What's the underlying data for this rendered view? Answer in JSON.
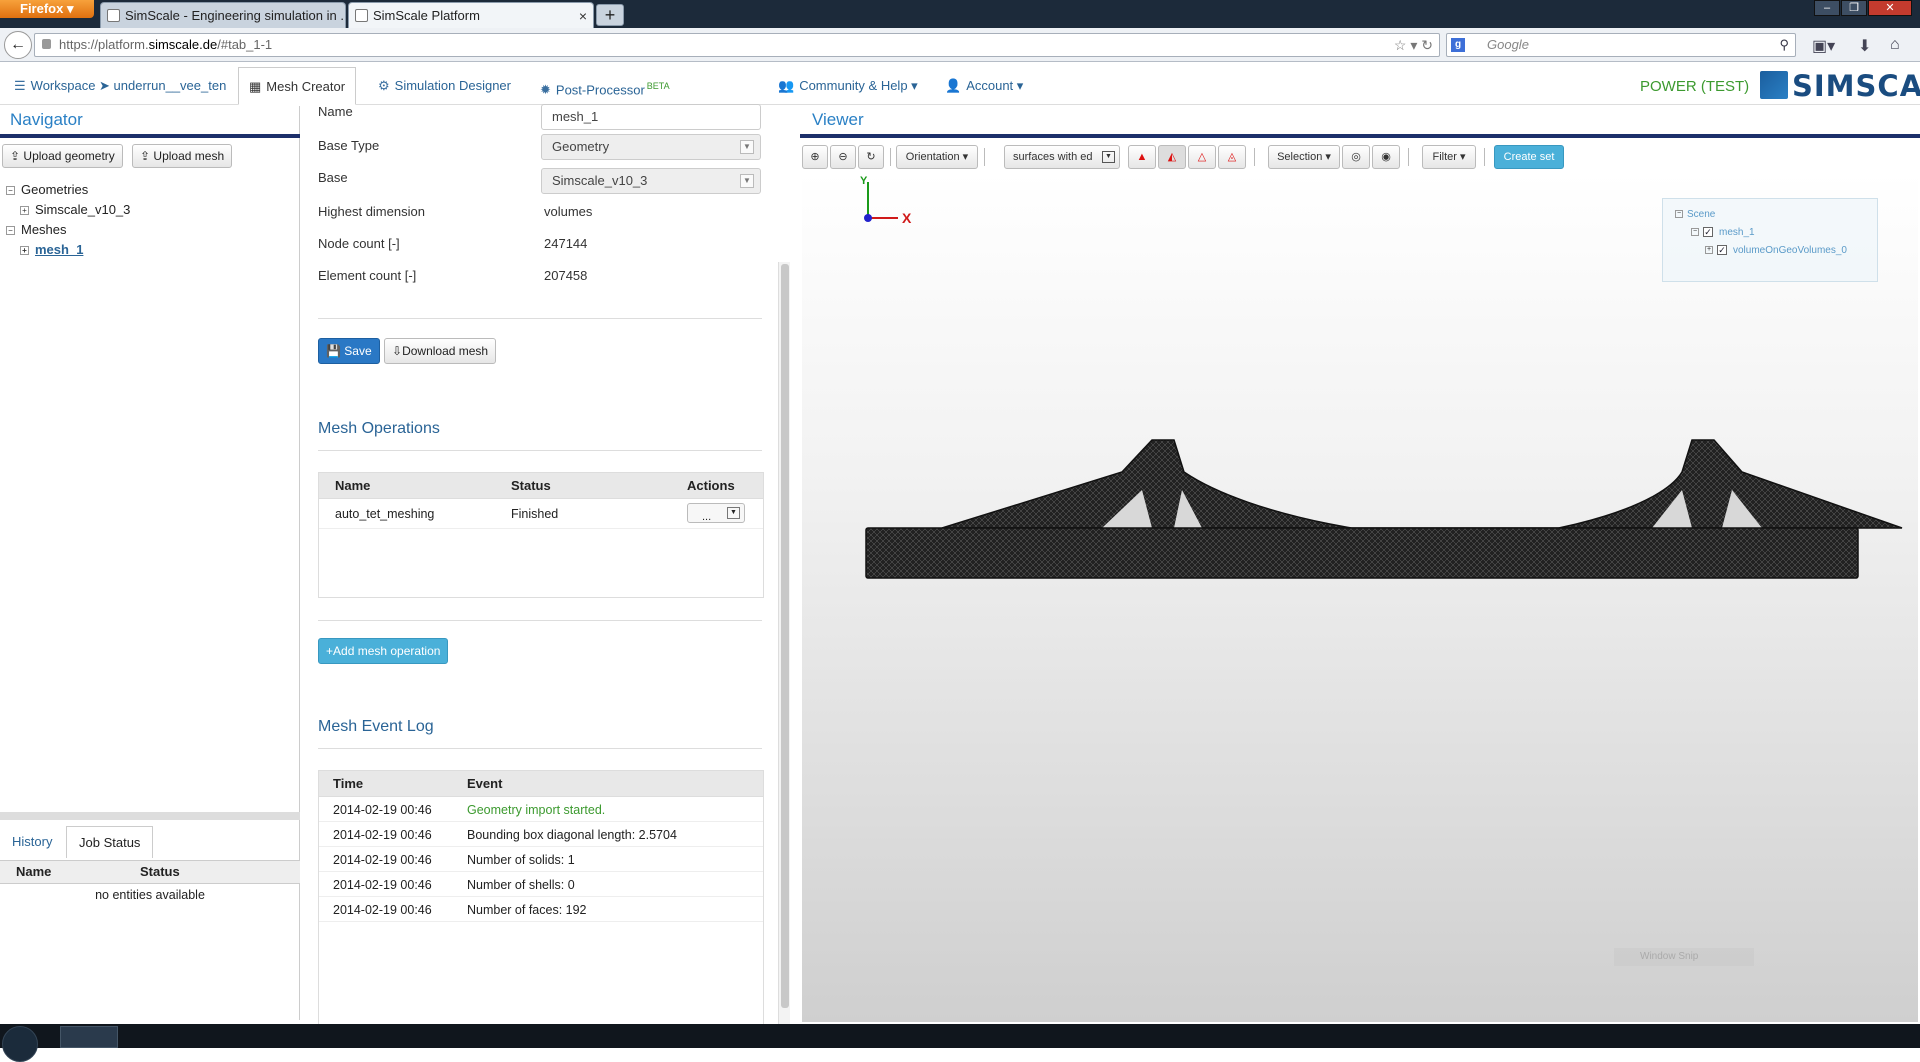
{
  "browser": {
    "app_button": "Firefox",
    "tabs": [
      {
        "label": "SimScale - Engineering simulation in ..."
      },
      {
        "label": "SimScale Platform"
      }
    ],
    "url_prefix": "https://platform.",
    "url_host": "simscale.de",
    "url_suffix": "/#tab_1-1",
    "search_placeholder": "Google"
  },
  "header": {
    "tabs": [
      {
        "label": "Workspace ➤ underrun__vee_ten"
      },
      {
        "label": "Mesh Creator"
      },
      {
        "label": "Simulation Designer"
      },
      {
        "label": "Post-Processor",
        "badge": "BETA"
      },
      {
        "label": "Community & Help"
      },
      {
        "label": "Account"
      }
    ],
    "plan": "POWER (TEST)",
    "logo_text": "SIMSCALE"
  },
  "navigator": {
    "title": "Navigator",
    "upload_geometry": "Upload geometry",
    "upload_mesh": "Upload mesh",
    "tree": {
      "geometries": "Geometries",
      "geometry_item": "Simscale_v10_3",
      "meshes": "Meshes",
      "mesh_item": "mesh_1"
    }
  },
  "jobs": {
    "tab_history": "History",
    "tab_status": "Job Status",
    "col_name": "Name",
    "col_status": "Status",
    "empty": "no entities available"
  },
  "mesh": {
    "name_label": "Name",
    "name_value": "mesh_1",
    "base_type_label": "Base Type",
    "base_type_value": "Geometry",
    "base_label": "Base",
    "base_value": "Simscale_v10_3",
    "highest_dim_label": "Highest dimension",
    "highest_dim_value": "volumes",
    "node_count_label": "Node count [-]",
    "node_count_value": "247144",
    "element_count_label": "Element count [-]",
    "element_count_value": "207458",
    "save": "Save",
    "download": "Download mesh"
  },
  "operations": {
    "title": "Mesh Operations",
    "col_name": "Name",
    "col_status": "Status",
    "col_actions": "Actions",
    "rows": [
      {
        "name": "auto_tet_meshing",
        "status": "Finished",
        "action": "..."
      }
    ],
    "add": "Add mesh operation"
  },
  "event_log": {
    "title": "Mesh Event Log",
    "col_time": "Time",
    "col_event": "Event",
    "rows": [
      {
        "time": "2014-02-19 00:46",
        "event": "Geometry import started."
      },
      {
        "time": "2014-02-19 00:46",
        "event": "Bounding box diagonal length: 2.5704"
      },
      {
        "time": "2014-02-19 00:46",
        "event": "Number of solids: 1"
      },
      {
        "time": "2014-02-19 00:46",
        "event": "Number of shells: 0"
      },
      {
        "time": "2014-02-19 00:46",
        "event": "Number of faces: 192"
      }
    ]
  },
  "viewer": {
    "title": "Viewer",
    "orientation": "Orientation",
    "render_mode": "surfaces with ed",
    "selection": "Selection",
    "filter": "Filter",
    "create_set": "Create set",
    "axis_x": "X",
    "axis_y": "Y",
    "scene": {
      "root": "Scene",
      "mesh": "mesh_1",
      "volume": "volumeOnGeoVolumes_0"
    },
    "snip": "Window Snip"
  },
  "colors": {
    "accent": "#2a80c5",
    "link": "#2a6496",
    "success": "#3c9a2f",
    "nav_bar": "#1c2f6a"
  }
}
